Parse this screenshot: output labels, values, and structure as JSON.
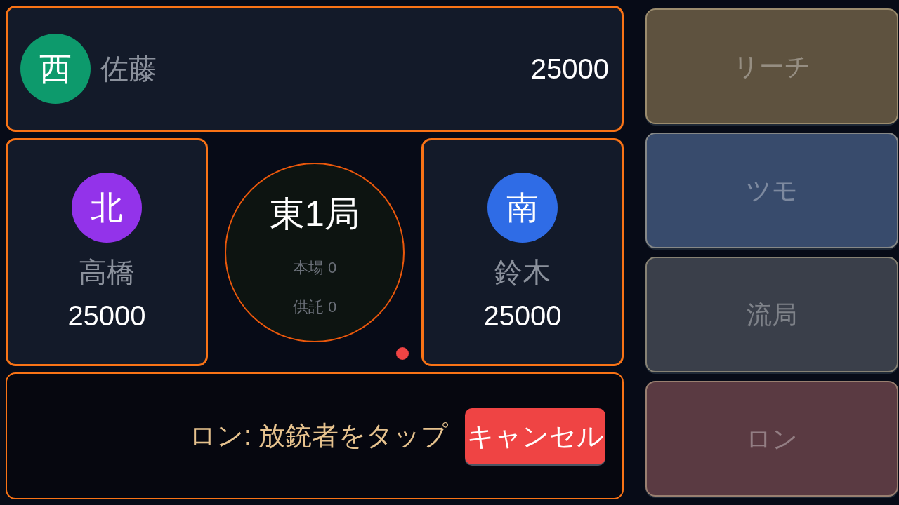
{
  "seats": [
    {
      "kind": "top",
      "wind": "西",
      "name": "佐藤",
      "score": "25000",
      "color": "#0d9a6c",
      "highlighted": true
    },
    {
      "kind": "side",
      "wind": "北",
      "name": "高橋",
      "score": "25000",
      "color": "#9333ea",
      "highlighted": true
    },
    {
      "kind": "side",
      "wind": "南",
      "name": "鈴木",
      "score": "25000",
      "color": "#2f6ce6",
      "highlighted": true
    }
  ],
  "round_info": {
    "round": "東1局",
    "honba": "本場 0",
    "deposit": "供託 0"
  },
  "prompt": {
    "text": "ロン: 放銃者をタップ",
    "cancel_button": "キャンセル"
  },
  "actions": [
    {
      "label": "リーチ",
      "color": "#5e523f",
      "disabled": true
    },
    {
      "label": "ツモ",
      "color": "#384b6c",
      "disabled": true
    },
    {
      "label": "流局",
      "color": "#3a3f4a",
      "disabled": true
    },
    {
      "label": "ロン",
      "color": "#5a3a42",
      "disabled": true
    }
  ]
}
